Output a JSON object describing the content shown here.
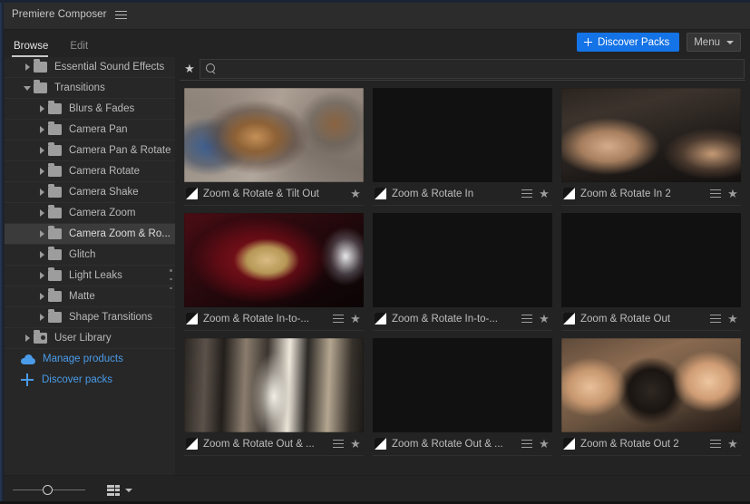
{
  "window": {
    "title": "Premiere Composer",
    "menu_icon": "hamburger-icon"
  },
  "tabs": [
    {
      "label": "Browse",
      "active": true
    },
    {
      "label": "Edit",
      "active": false
    }
  ],
  "toolbar": {
    "discover_packs_label": "Discover Packs",
    "menu_label": "Menu",
    "accent_color": "#1473e6"
  },
  "search": {
    "value": "",
    "placeholder": "",
    "favorites_filter_icon": "star-icon",
    "search_icon": "search-icon"
  },
  "sidebar": {
    "items": [
      {
        "label": "Essential Sound Effects",
        "icon": "folder-icon",
        "twisty": "right",
        "indent": 0,
        "selected": false,
        "link": false
      },
      {
        "label": "Transitions",
        "icon": "folder-icon",
        "twisty": "down",
        "indent": 0,
        "selected": false,
        "link": false
      },
      {
        "label": "Blurs & Fades",
        "icon": "folder-icon",
        "twisty": "right",
        "indent": 1,
        "selected": false,
        "link": false
      },
      {
        "label": "Camera Pan",
        "icon": "folder-icon",
        "twisty": "right",
        "indent": 1,
        "selected": false,
        "link": false
      },
      {
        "label": "Camera Pan & Rotate",
        "icon": "folder-icon",
        "twisty": "right",
        "indent": 1,
        "selected": false,
        "link": false
      },
      {
        "label": "Camera Rotate",
        "icon": "folder-icon",
        "twisty": "right",
        "indent": 1,
        "selected": false,
        "link": false
      },
      {
        "label": "Camera Shake",
        "icon": "folder-icon",
        "twisty": "right",
        "indent": 1,
        "selected": false,
        "link": false
      },
      {
        "label": "Camera Zoom",
        "icon": "folder-icon",
        "twisty": "right",
        "indent": 1,
        "selected": false,
        "link": false
      },
      {
        "label": "Camera Zoom & Ro...",
        "icon": "folder-icon",
        "twisty": "right",
        "indent": 1,
        "selected": true,
        "link": false
      },
      {
        "label": "Glitch",
        "icon": "folder-icon",
        "twisty": "right",
        "indent": 1,
        "selected": false,
        "link": false
      },
      {
        "label": "Light Leaks",
        "icon": "folder-icon",
        "twisty": "right",
        "indent": 1,
        "selected": false,
        "link": false
      },
      {
        "label": "Matte",
        "icon": "folder-icon",
        "twisty": "right",
        "indent": 1,
        "selected": false,
        "link": false
      },
      {
        "label": "Shape Transitions",
        "icon": "folder-icon",
        "twisty": "right",
        "indent": 1,
        "selected": false,
        "link": false
      },
      {
        "label": "User Library",
        "icon": "user-library-icon",
        "twisty": "right",
        "indent": 0,
        "selected": false,
        "link": false
      },
      {
        "label": "Manage products",
        "icon": "cloud-icon",
        "twisty": "none",
        "indent": 2,
        "selected": false,
        "link": true
      },
      {
        "label": "Discover packs",
        "icon": "plus-icon",
        "twisty": "none",
        "indent": 2,
        "selected": false,
        "link": true
      }
    ],
    "link_color": "#4a9be8"
  },
  "grid": {
    "items": [
      {
        "title": "Zoom & Rotate & Tilt Out",
        "has_menu": false,
        "starred": false,
        "thumb": "t1"
      },
      {
        "title": "Zoom & Rotate In",
        "has_menu": true,
        "starred": false,
        "thumb": "t2"
      },
      {
        "title": "Zoom & Rotate In 2",
        "has_menu": true,
        "starred": false,
        "thumb": "t3"
      },
      {
        "title": "Zoom & Rotate In-to-...",
        "has_menu": true,
        "starred": false,
        "thumb": "t4"
      },
      {
        "title": "Zoom & Rotate In-to-...",
        "has_menu": true,
        "starred": false,
        "thumb": "t5"
      },
      {
        "title": "Zoom & Rotate Out",
        "has_menu": true,
        "starred": false,
        "thumb": "t6"
      },
      {
        "title": "Zoom & Rotate Out & ...",
        "has_menu": true,
        "starred": false,
        "thumb": "t7"
      },
      {
        "title": "Zoom & Rotate Out & ...",
        "has_menu": true,
        "starred": false,
        "thumb": "t8"
      },
      {
        "title": "Zoom & Rotate Out 2",
        "has_menu": true,
        "starred": false,
        "thumb": "t9"
      }
    ],
    "star_glyph": "★",
    "clip_icon": "clip-thumbnail-icon"
  },
  "bottombar": {
    "zoom_slider_value": 42,
    "view_mode_icon": "list-view-icon",
    "view_mode_chevron": "chevron-down-icon"
  }
}
